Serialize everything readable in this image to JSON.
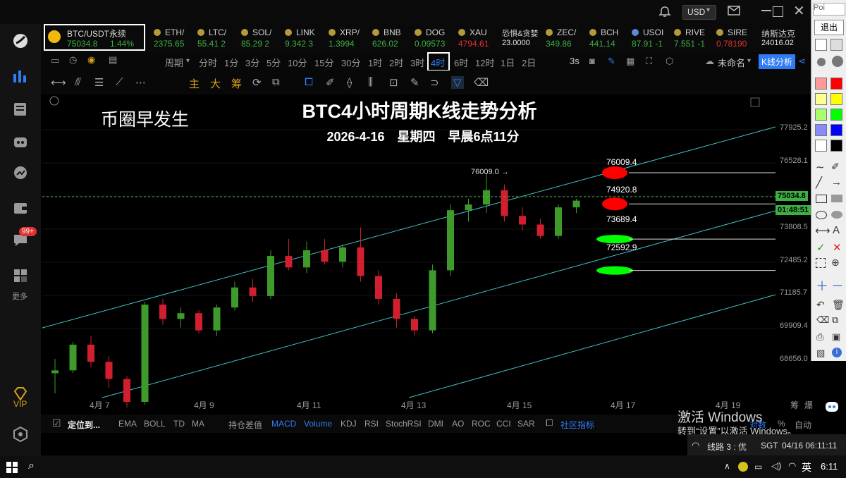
{
  "header": {
    "currency": "USD",
    "exit_label": "退出",
    "search_placeholder": "Poi"
  },
  "sidebar": {
    "more_label": "更多",
    "badge": "99+",
    "vip_label": "VIP"
  },
  "tickers": [
    {
      "symbol": "BTC/USDT永续",
      "value": "75034.8",
      "change": "1.44%"
    },
    {
      "symbol": "ETH/",
      "value": "2375.65"
    },
    {
      "symbol": "LTC/",
      "value": "55.41 2"
    },
    {
      "symbol": "SOL/",
      "value": "85.29 2"
    },
    {
      "symbol": "LINK",
      "value": "9.342 3"
    },
    {
      "symbol": "XRP/",
      "value": "1.3994"
    },
    {
      "symbol": "BNB",
      "value": "626.02"
    },
    {
      "symbol": "DOG",
      "value": "0.09573"
    },
    {
      "symbol": "XAU",
      "value": "4794.61"
    },
    {
      "symbol": "恐惧&贪婪",
      "value": "23.0000"
    },
    {
      "symbol": "ZEC/",
      "value": "349.86"
    },
    {
      "symbol": "BCH",
      "value": "441.14"
    },
    {
      "symbol": "USOI",
      "value": "87.91 -1"
    },
    {
      "symbol": "RIVE",
      "value": "7.551 -1"
    },
    {
      "symbol": "SIRE",
      "value": "0.78190"
    },
    {
      "symbol": "纳斯达克",
      "value": "24016.02"
    }
  ],
  "timeframes": {
    "period_label": "周期",
    "items": [
      "分时",
      "1分",
      "3分",
      "5分",
      "10分",
      "15分",
      "30分",
      "1时",
      "2时",
      "3时",
      "4时",
      "6时",
      "12时",
      "1日",
      "2日"
    ],
    "selected": "4时",
    "interval": "3s",
    "layout_name": "未命名",
    "kline_button": "K线分析"
  },
  "tools": {
    "main_labels": [
      "主",
      "大",
      "筹"
    ]
  },
  "chart": {
    "title": "BTC4小时周期K线走势分析",
    "date_line": "2026-4-16　星期四　早晨6点11分",
    "left_caption": "币圈早发生",
    "current_price": "75034.8",
    "countdown": "01:48:51",
    "high_marker": "76009.0 →",
    "price_axis": [
      "77925.2",
      "76528.1",
      "73808.5",
      "72485.2",
      "71185.7",
      "69909.4",
      "68656.0"
    ],
    "date_axis": [
      "4月 7",
      "4月 9",
      "4月 11",
      "4月 13",
      "4月 15",
      "4月 17",
      "4月 19"
    ],
    "levels": [
      {
        "label": "76009.4",
        "color": "#ff0000"
      },
      {
        "label": "74920.8",
        "color": "#ff0000"
      },
      {
        "label": "73689.4",
        "color": "#00ff00"
      },
      {
        "label": "72592.9",
        "color": "#00ff00"
      }
    ],
    "up_color": "#3f9a2c",
    "down_color": "#d11f2f",
    "channel_color": "#3fc1c9"
  },
  "chart_data": {
    "type": "candlestick",
    "x": [
      "4月7",
      "4月9",
      "4月11",
      "4月13",
      "4月15",
      "4月17",
      "4月19"
    ],
    "ohlc_approx": [
      [
        69000,
        69500,
        68300,
        69100
      ],
      [
        69100,
        70100,
        69000,
        70000
      ],
      [
        70000,
        70300,
        69200,
        69400
      ],
      [
        69400,
        69600,
        68500,
        68800
      ],
      [
        68800,
        68900,
        67800,
        68000
      ],
      [
        68000,
        71500,
        67900,
        71400
      ],
      [
        71400,
        71600,
        70700,
        70900
      ],
      [
        70900,
        71300,
        70600,
        71100
      ],
      [
        71100,
        71200,
        70400,
        70500
      ],
      [
        70500,
        71400,
        70300,
        71300
      ],
      [
        71300,
        72200,
        71200,
        72000
      ],
      [
        72000,
        72300,
        71500,
        71700
      ],
      [
        71700,
        73300,
        71600,
        73100
      ],
      [
        73100,
        73700,
        72600,
        72700
      ],
      [
        72700,
        73600,
        72500,
        73300
      ],
      [
        73300,
        73700,
        72800,
        72900
      ],
      [
        72900,
        73500,
        72700,
        73400
      ],
      [
        73400,
        74100,
        72200,
        72400
      ],
      [
        72400,
        72600,
        71400,
        71600
      ],
      [
        71600,
        71800,
        70600,
        70900
      ],
      [
        70900,
        71000,
        70300,
        70500
      ],
      [
        70500,
        72800,
        70400,
        72600
      ],
      [
        72600,
        74900,
        72400,
        74700
      ],
      [
        74700,
        75100,
        74300,
        74900
      ],
      [
        74900,
        76009,
        74600,
        75400
      ],
      [
        75400,
        75600,
        74300,
        74500
      ],
      [
        74500,
        74800,
        74000,
        74200
      ],
      [
        74200,
        74400,
        73700,
        73800
      ],
      [
        73800,
        74900,
        73700,
        74800
      ],
      [
        74800,
        75100,
        74600,
        75034.8
      ]
    ],
    "levels": [
      76009.4,
      74920.8,
      73689.4,
      72592.9
    ],
    "ylim": [
      68000,
      78500
    ]
  },
  "indicators": {
    "locate_label": "定位到...",
    "items": [
      "EMA",
      "BOLL",
      "TD",
      "MA",
      "持仓差值",
      "MACD",
      "Volume",
      "KDJ",
      "RSI",
      "StochRSI",
      "DMI",
      "AO",
      "ROC",
      "CCI",
      "SAR"
    ],
    "community": "社区指标",
    "active": [
      "MACD",
      "Volume"
    ]
  },
  "right_panel": {
    "bottom_labels": [
      "筹",
      "爆"
    ],
    "auto_label": "自动",
    "log_label": "对数",
    "pct_label": "%"
  },
  "watermark": {
    "line1": "激活 Windows",
    "line2": "转到“设置”以激活 Windows。"
  },
  "status": {
    "line_info": "线路 3 : 优",
    "timezone": "SGT",
    "datetime": "04/16 06:11:11"
  },
  "taskbar": {
    "ime": "英",
    "clock": "6:11"
  }
}
